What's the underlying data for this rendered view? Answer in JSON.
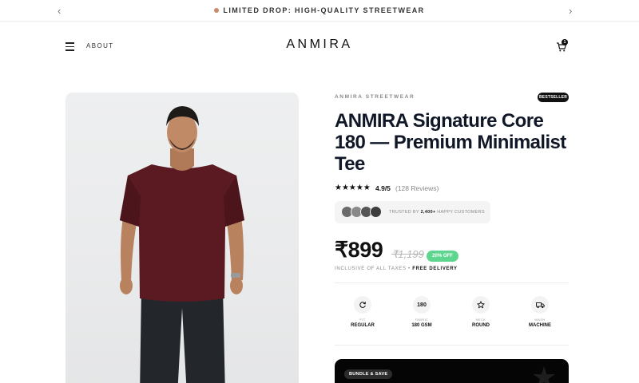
{
  "announcement": {
    "text": "LIMITED DROP: HIGH-QUALITY STREETWEAR",
    "prev_icon": "chevron-left-icon",
    "next_icon": "chevron-right-icon",
    "dot_color": "#c98a6a"
  },
  "header": {
    "menu_icon": "hamburger-menu-icon",
    "about_label": "ABOUT",
    "logo": "ANMIRA",
    "cart_icon": "cart-icon",
    "cart_count": "1"
  },
  "product": {
    "image_alt": "Man wearing maroon t-shirt",
    "shirt_color": "#5b1a22",
    "brand": "ANMIRA STREETWEAR",
    "badge": "BESTSELLER",
    "title": "ANMIRA Signature Core 180 — Premium Minimalist Tee",
    "stars": "★★★★★",
    "rating": "4.9/5",
    "reviews": "(128 Reviews)",
    "trust": {
      "prefix": "TRUSTED BY",
      "count": "2,400+",
      "suffix": "HAPPY CUSTOMERS"
    },
    "price": "₹899",
    "compare_price": "₹1,199",
    "discount": "20% OFF",
    "tax_note": "INCLUSIVE OF ALL TAXES •",
    "delivery": "FREE DELIVERY",
    "features": [
      {
        "icon": "refresh-icon",
        "label": "FIT",
        "value": "REGULAR"
      },
      {
        "icon_text": "180",
        "label": "FABRIC",
        "value": "180 GSM"
      },
      {
        "icon": "star-outline-icon",
        "label": "NECK",
        "value": "ROUND"
      },
      {
        "icon": "truck-icon",
        "label": "WASH",
        "value": "MACHINE"
      }
    ],
    "bundle_label": "BUNDLE & SAVE"
  },
  "colors": {
    "accent_green": "#5fd68f",
    "dark": "#111111"
  }
}
